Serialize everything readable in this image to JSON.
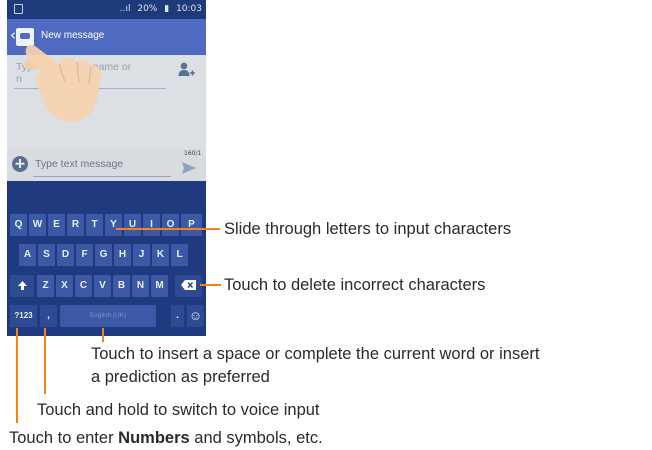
{
  "status": {
    "signal": "‥ıl",
    "battery": "20%",
    "battery_icon": "battery-icon",
    "time": "10:03"
  },
  "appbar": {
    "title": "New message"
  },
  "recipient": {
    "placeholder_visible": "Type ...n's name or num..."
  },
  "compose": {
    "placeholder": "Type text message",
    "counter": "160/1"
  },
  "keyboard": {
    "row1": [
      "Q",
      "W",
      "E",
      "R",
      "T",
      "Y",
      "U",
      "I",
      "O",
      "P"
    ],
    "row2": [
      "A",
      "S",
      "D",
      "F",
      "G",
      "H",
      "J",
      "K",
      "L"
    ],
    "row3": [
      "Z",
      "X",
      "C",
      "V",
      "B",
      "N",
      "M"
    ],
    "symbols_label": "?123",
    "comma_label": ",",
    "space_label": "English (UK)",
    "period_label": ".",
    "emoji_label": "☺"
  },
  "callouts": {
    "slide": "Slide through letters to input characters",
    "delete": "Touch to delete incorrect characters",
    "space_line1": "Touch to insert a space or complete the current word or insert",
    "space_line2": "a prediction as preferred",
    "voice": "Touch and hold to switch to voice input",
    "numbers_pre": "Touch to enter ",
    "numbers_bold": "Numbers",
    "numbers_post": " and symbols, etc."
  },
  "colors": {
    "accent_line": "#f58220",
    "keyboard_bg": "#1f3a7e",
    "key_bg": "#3b59a5",
    "appbar": "#4f6bc1"
  }
}
